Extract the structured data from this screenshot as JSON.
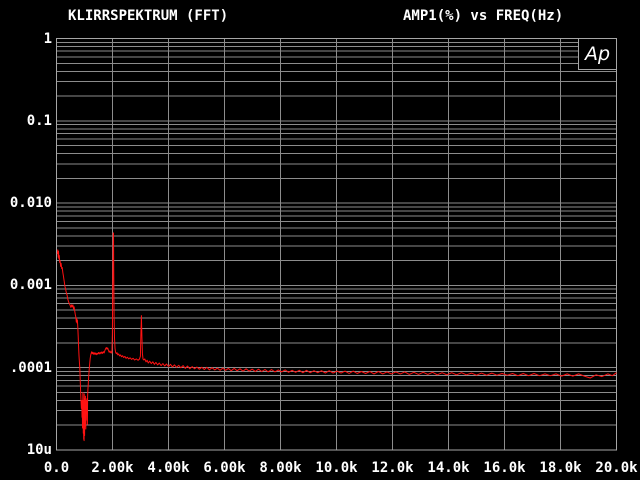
{
  "page": {
    "background": "#000000",
    "text_color": "#ffffff"
  },
  "logo": {
    "text": "Ap"
  },
  "chart_data": {
    "type": "line",
    "title": "KLIRRSPEKTRUM (FFT)",
    "right_title": "AMP1(%) vs FREQ(Hz)",
    "grid": {
      "show": true,
      "color": "#8c8c8c",
      "border_color": "#a6a6a6",
      "log_minor_lines": true
    },
    "x_axis": {
      "scale": "linear",
      "min": 0,
      "max": 20000,
      "ticks": [
        {
          "value": 0,
          "label": "0.0"
        },
        {
          "value": 2000,
          "label": "2.00k"
        },
        {
          "value": 4000,
          "label": "4.00k"
        },
        {
          "value": 6000,
          "label": "6.00k"
        },
        {
          "value": 8000,
          "label": "8.00k"
        },
        {
          "value": 10000,
          "label": "10.0k"
        },
        {
          "value": 12000,
          "label": "12.0k"
        },
        {
          "value": 14000,
          "label": "14.0k"
        },
        {
          "value": 16000,
          "label": "16.0k"
        },
        {
          "value": 18000,
          "label": "18.0k"
        },
        {
          "value": 20000,
          "label": "20.0k"
        }
      ]
    },
    "y_axis": {
      "scale": "log",
      "min": 1e-05,
      "max": 1,
      "ticks": [
        {
          "value": 1,
          "label": "1"
        },
        {
          "value": 0.1,
          "label": "0.1"
        },
        {
          "value": 0.01,
          "label": "0.010"
        },
        {
          "value": 0.001,
          "label": "0.001"
        },
        {
          "value": 0.0001,
          "label": ".0001"
        },
        {
          "value": 1e-05,
          "label": "10u"
        }
      ]
    },
    "series": [
      {
        "name": "AMP1",
        "color": "#ff1212",
        "points": [
          [
            30,
            0.0024
          ],
          [
            45,
            0.0027
          ],
          [
            60,
            0.0022
          ],
          [
            72,
            0.0026
          ],
          [
            85,
            0.0021
          ],
          [
            100,
            0.0023
          ],
          [
            115,
            0.0019
          ],
          [
            130,
            0.002
          ],
          [
            148,
            0.0017
          ],
          [
            165,
            0.00185
          ],
          [
            185,
            0.0016
          ],
          [
            205,
            0.00165
          ],
          [
            228,
            0.00142
          ],
          [
            250,
            0.00128
          ],
          [
            275,
            0.00112
          ],
          [
            300,
            0.00098
          ],
          [
            325,
            0.0009
          ],
          [
            350,
            0.00082
          ],
          [
            378,
            0.00076
          ],
          [
            405,
            0.00068
          ],
          [
            432,
            0.00063
          ],
          [
            460,
            0.0006
          ],
          [
            488,
            0.00057
          ],
          [
            515,
            0.00054
          ],
          [
            540,
            0.00058
          ],
          [
            562,
            0.00055
          ],
          [
            585,
            0.00058
          ],
          [
            608,
            0.00052
          ],
          [
            630,
            0.00055
          ],
          [
            652,
            0.00048
          ],
          [
            672,
            0.00044
          ],
          [
            692,
            0.00041
          ],
          [
            706,
            0.00036
          ],
          [
            718,
            0.0004
          ],
          [
            732,
            0.00035
          ],
          [
            746,
            0.00038
          ],
          [
            760,
            0.00031
          ],
          [
            775,
            0.00024
          ],
          [
            790,
            0.00018
          ],
          [
            805,
            0.00014
          ],
          [
            820,
            0.000112
          ],
          [
            832,
            9.8e-05
          ],
          [
            845,
            7.2e-05
          ],
          [
            860,
            5.2e-05
          ],
          [
            875,
            4e-05
          ],
          [
            890,
            3.2e-05
          ],
          [
            902,
            4e-05
          ],
          [
            912,
            2.5e-05
          ],
          [
            920,
            3.4e-05
          ],
          [
            928,
            1.85e-05
          ],
          [
            935,
            3e-05
          ],
          [
            942,
            5e-05
          ],
          [
            950,
            2.8e-05
          ],
          [
            958,
            1.6e-05
          ],
          [
            966,
            4e-05
          ],
          [
            973,
            1.35e-05
          ],
          [
            980,
            2.8e-05
          ],
          [
            985,
            1.3e-05
          ],
          [
            991,
            4.8e-05
          ],
          [
            998,
            2.4e-05
          ],
          [
            1004,
            1.5e-05
          ],
          [
            1010,
            4.2e-05
          ],
          [
            1017,
            2.6e-05
          ],
          [
            1024,
            1.95e-05
          ],
          [
            1031,
            4.5e-05
          ],
          [
            1039,
            2.8e-05
          ],
          [
            1046,
            1.8e-05
          ],
          [
            1054,
            4e-05
          ],
          [
            1061,
            2.3e-05
          ],
          [
            1068,
            3.4e-05
          ],
          [
            1077,
            2.8e-05
          ],
          [
            1086,
            4.2e-05
          ],
          [
            1095,
            3.6e-05
          ],
          [
            1103,
            2.05e-05
          ],
          [
            1112,
            4.4e-05
          ],
          [
            1122,
            5.4e-05
          ],
          [
            1135,
            6.4e-05
          ],
          [
            1148,
            7.6e-05
          ],
          [
            1162,
            8.8e-05
          ],
          [
            1176,
            0.000102
          ],
          [
            1190,
            0.000116
          ],
          [
            1205,
            0.00013
          ],
          [
            1220,
            0.000142
          ],
          [
            1238,
            0.00015
          ],
          [
            1258,
            0.000156
          ],
          [
            1278,
            0.000148
          ],
          [
            1300,
            0.000154
          ],
          [
            1322,
            0.000146
          ],
          [
            1346,
            0.000152
          ],
          [
            1370,
            0.000145
          ],
          [
            1395,
            0.000151
          ],
          [
            1420,
            0.000144
          ],
          [
            1446,
            0.00015
          ],
          [
            1472,
            0.000146
          ],
          [
            1500,
            0.000153
          ],
          [
            1528,
            0.000147
          ],
          [
            1556,
            0.000154
          ],
          [
            1585,
            0.000148
          ],
          [
            1614,
            0.000155
          ],
          [
            1643,
            0.000149
          ],
          [
            1672,
            0.000157
          ],
          [
            1700,
            0.000151
          ],
          [
            1728,
            0.000162
          ],
          [
            1755,
            0.00017
          ],
          [
            1780,
            0.000176
          ],
          [
            1805,
            0.000168
          ],
          [
            1830,
            0.000174
          ],
          [
            1856,
            0.000162
          ],
          [
            1882,
            0.000154
          ],
          [
            1908,
            0.00016
          ],
          [
            1934,
            0.000152
          ],
          [
            1960,
            0.000157
          ],
          [
            1980,
            0.00015
          ],
          [
            1998,
            0.00026
          ],
          [
            2012,
            0.0013
          ],
          [
            2024,
            0.0043
          ],
          [
            2034,
            0.00435
          ],
          [
            2044,
            0.0016
          ],
          [
            2056,
            0.00042
          ],
          [
            2070,
            0.00023
          ],
          [
            2088,
            0.000172
          ],
          [
            2110,
            0.000154
          ],
          [
            2135,
            0.000148
          ],
          [
            2162,
            0.000152
          ],
          [
            2190,
            0.000143
          ],
          [
            2220,
            0.000147
          ],
          [
            2252,
            0.000139
          ],
          [
            2286,
            0.000143
          ],
          [
            2322,
            0.000136
          ],
          [
            2360,
            0.00014
          ],
          [
            2400,
            0.000133
          ],
          [
            2442,
            0.000137
          ],
          [
            2486,
            0.00013
          ],
          [
            2532,
            0.000134
          ],
          [
            2580,
            0.000128
          ],
          [
            2630,
            0.000132
          ],
          [
            2682,
            0.000126
          ],
          [
            2736,
            0.00013
          ],
          [
            2792,
            0.000124
          ],
          [
            2850,
            0.000128
          ],
          [
            2910,
            0.000123
          ],
          [
            2960,
            0.000127
          ],
          [
            2995,
            0.000138
          ],
          [
            3015,
            0.00026
          ],
          [
            3032,
            0.00043
          ],
          [
            3050,
            0.00024
          ],
          [
            3068,
            0.00015
          ],
          [
            3090,
            0.000128
          ],
          [
            3120,
            0.000124
          ],
          [
            3155,
            0.000128
          ],
          [
            3195,
            0.000118
          ],
          [
            3235,
            0.000123
          ],
          [
            3280,
            0.000114
          ],
          [
            3330,
            0.00012
          ],
          [
            3385,
            0.000112
          ],
          [
            3440,
            0.000118
          ],
          [
            3495,
            0.00011
          ],
          [
            3550,
            0.000116
          ],
          [
            3610,
            0.000108
          ],
          [
            3670,
            0.000114
          ],
          [
            3735,
            0.000106
          ],
          [
            3800,
            0.000112
          ],
          [
            3865,
            0.000105
          ],
          [
            3930,
            0.000111
          ],
          [
            4000,
            0.000103
          ],
          [
            4070,
            0.00011
          ],
          [
            4140,
            0.000102
          ],
          [
            4215,
            0.000108
          ],
          [
            4290,
            0.000101
          ],
          [
            4365,
            0.000107
          ],
          [
            4440,
            0.0001
          ],
          [
            4520,
            0.000106
          ],
          [
            4600,
            9.8e-05
          ],
          [
            4680,
            0.000105
          ],
          [
            4760,
            9.7e-05
          ],
          [
            4845,
            0.000103
          ],
          [
            4930,
            9.7e-05
          ],
          [
            5015,
            0.000102
          ],
          [
            5100,
            9.6e-05
          ],
          [
            5190,
            0.000101
          ],
          [
            5280,
            9.5e-05
          ],
          [
            5370,
            0.000101
          ],
          [
            5460,
            9.4e-05
          ],
          [
            5555,
            0.0001
          ],
          [
            5650,
            9.4e-05
          ],
          [
            5745,
            9.9e-05
          ],
          [
            5840,
            9.3e-05
          ],
          [
            5940,
            9.9e-05
          ],
          [
            6040,
            9.3e-05
          ],
          [
            6140,
            9.8e-05
          ],
          [
            6240,
            9.2e-05
          ],
          [
            6345,
            9.8e-05
          ],
          [
            6450,
            9.2e-05
          ],
          [
            6555,
            9.7e-05
          ],
          [
            6660,
            9.1e-05
          ],
          [
            6770,
            9.7e-05
          ],
          [
            6880,
            9.1e-05
          ],
          [
            6990,
            9.6e-05
          ],
          [
            7100,
            9e-05
          ],
          [
            7215,
            9.6e-05
          ],
          [
            7330,
            9e-05
          ],
          [
            7445,
            9.5e-05
          ],
          [
            7560,
            8.9e-05
          ],
          [
            7680,
            9.5e-05
          ],
          [
            7800,
            8.9e-05
          ],
          [
            7920,
            9.4e-05
          ],
          [
            8040,
            8.9e-05
          ],
          [
            8165,
            9.4e-05
          ],
          [
            8290,
            8.8e-05
          ],
          [
            8415,
            9.3e-05
          ],
          [
            8540,
            8.8e-05
          ],
          [
            8670,
            9.3e-05
          ],
          [
            8800,
            8.7e-05
          ],
          [
            8930,
            9.3e-05
          ],
          [
            9060,
            8.7e-05
          ],
          [
            9195,
            9.2e-05
          ],
          [
            9330,
            8.7e-05
          ],
          [
            9465,
            9.2e-05
          ],
          [
            9600,
            8.6e-05
          ],
          [
            9740,
            9.2e-05
          ],
          [
            9880,
            8.6e-05
          ],
          [
            10020,
            9.1e-05
          ],
          [
            10160,
            8.6e-05
          ],
          [
            10305,
            9.1e-05
          ],
          [
            10450,
            8.5e-05
          ],
          [
            10595,
            9.1e-05
          ],
          [
            10740,
            8.5e-05
          ],
          [
            10890,
            9e-05
          ],
          [
            11040,
            8.5e-05
          ],
          [
            11190,
            9e-05
          ],
          [
            11340,
            8.4e-05
          ],
          [
            11495,
            9e-05
          ],
          [
            11650,
            8.4e-05
          ],
          [
            11805,
            8.9e-05
          ],
          [
            11960,
            8.4e-05
          ],
          [
            12120,
            8.9e-05
          ],
          [
            12280,
            8.4e-05
          ],
          [
            12440,
            8.9e-05
          ],
          [
            12600,
            8.3e-05
          ],
          [
            12765,
            8.8e-05
          ],
          [
            12930,
            8.3e-05
          ],
          [
            13095,
            8.8e-05
          ],
          [
            13260,
            8.3e-05
          ],
          [
            13430,
            8.8e-05
          ],
          [
            13600,
            8.2e-05
          ],
          [
            13770,
            8.7e-05
          ],
          [
            13940,
            8.2e-05
          ],
          [
            14115,
            8.7e-05
          ],
          [
            14290,
            8.2e-05
          ],
          [
            14465,
            8.7e-05
          ],
          [
            14640,
            8.2e-05
          ],
          [
            14820,
            8.6e-05
          ],
          [
            15000,
            8.1e-05
          ],
          [
            15180,
            8.6e-05
          ],
          [
            15360,
            8.1e-05
          ],
          [
            15545,
            8.6e-05
          ],
          [
            15730,
            8.1e-05
          ],
          [
            15915,
            8.5e-05
          ],
          [
            16100,
            8.1e-05
          ],
          [
            16290,
            8.5e-05
          ],
          [
            16480,
            8e-05
          ],
          [
            16670,
            8.5e-05
          ],
          [
            16860,
            8e-05
          ],
          [
            17055,
            8.5e-05
          ],
          [
            17250,
            8e-05
          ],
          [
            17445,
            8.4e-05
          ],
          [
            17640,
            8e-05
          ],
          [
            17840,
            8.4e-05
          ],
          [
            18040,
            7.9e-05
          ],
          [
            18240,
            8.4e-05
          ],
          [
            18440,
            7.9e-05
          ],
          [
            18645,
            8.4e-05
          ],
          [
            18850,
            7.9e-05
          ],
          [
            19060,
            7.5e-05
          ],
          [
            19270,
            8.2e-05
          ],
          [
            19480,
            7.8e-05
          ],
          [
            19690,
            8.4e-05
          ],
          [
            19850,
            8e-05
          ],
          [
            20000,
            8.7e-05
          ]
        ]
      }
    ]
  }
}
